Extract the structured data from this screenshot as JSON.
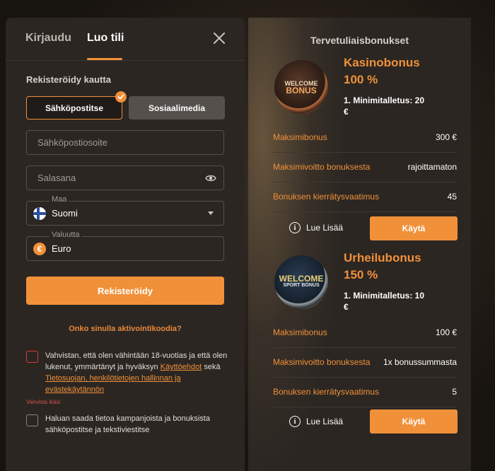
{
  "auth": {
    "tabs": {
      "login": "Kirjaudu",
      "register": "Luo tili"
    },
    "register_via_label": "Rekisteröidy kautta",
    "methods": {
      "email": "Sähköpostitse",
      "social": "Sosiaalimedia"
    },
    "email_placeholder": "Sähköpostiosoite",
    "password_placeholder": "Salasana",
    "country": {
      "label": "Maa",
      "value": "Suomi"
    },
    "currency": {
      "label": "Valuutta",
      "value": "Euro",
      "symbol": "€"
    },
    "register_button": "Rekisteröidy",
    "promo_link": "Onko sinulla aktivointikoodia?",
    "terms": {
      "text_before": "Vahvistan, että olen vähintään 18-vuotias ja että olen lukenut, ymmärtänyt ja hyväksyn ",
      "link_terms": "Käyttöehdot",
      "text_mid": " sekä ",
      "link_privacy": "Tietosuojan, henkilötietojen hallinnan ja evästekäytännön",
      "error": "Vahvista ikäsi"
    },
    "marketing_consent": "Haluan saada tietoa kampanjoista ja bonuksista sähköpostitse ja tekstiviestitse"
  },
  "bonuses": {
    "title": "Tervetuliaisbonukset",
    "casino": {
      "coin": {
        "top": "WELCOME",
        "big": "BONUS"
      },
      "name": "Kasinobonus",
      "percent": "100 %",
      "deposit": "1. Minimitalletus: 20 €",
      "rows": [
        {
          "k": "Maksimibonus",
          "v": "300 €"
        },
        {
          "k": "Maksimivoitto bonuksesta",
          "v": "rajoittamaton"
        },
        {
          "k": "Bonuksen kierrätysvaatimus",
          "v": "45"
        }
      ],
      "more": "Lue Lisää",
      "use": "Käytä"
    },
    "sport": {
      "coin": {
        "big": "WELCOME",
        "small": "SPORT BONUS"
      },
      "name": "Urheilubonus",
      "percent": "150 %",
      "deposit": "1. Minimitalletus: 10 €",
      "rows": [
        {
          "k": "Maksimibonus",
          "v": "100 €"
        },
        {
          "k": "Maksimivoitto bonuksesta",
          "v": "1x bonussummasta"
        },
        {
          "k": "Bonuksen kierrätysvaatimus",
          "v": "5"
        }
      ],
      "more": "Lue Lisää",
      "use": "Käytä"
    }
  },
  "colors": {
    "accent": "#f0913a",
    "panel": "#2b2622",
    "error": "#d33b3b"
  }
}
